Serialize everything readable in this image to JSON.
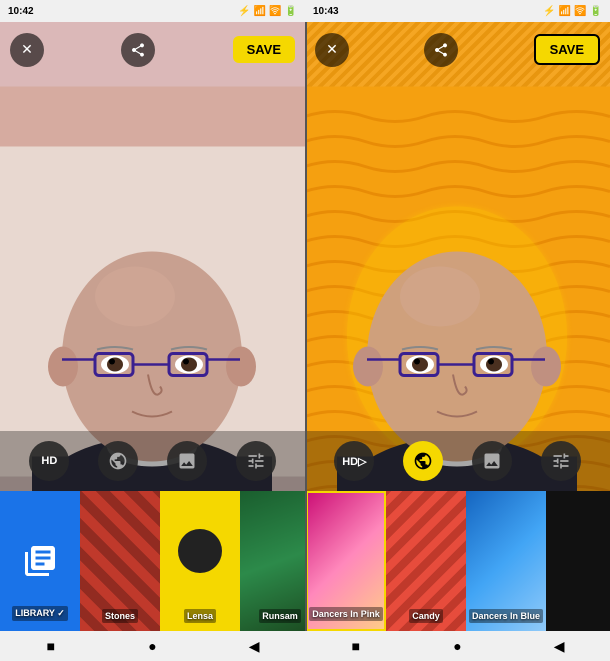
{
  "statusBar": {
    "left": {
      "time": "10:42",
      "icons": [
        "bluetooth",
        "signal",
        "wifi",
        "battery"
      ]
    },
    "right": {
      "time": "10:43",
      "icons": [
        "bluetooth",
        "signal",
        "wifi",
        "battery"
      ]
    }
  },
  "toolbar": {
    "close_label": "✕",
    "share_label": "◀",
    "save_label": "SAVE",
    "save_label_right": "SAVE"
  },
  "controls": {
    "hd_label": "HD",
    "hd_label_right": "HD▷"
  },
  "filters": {
    "left": [
      {
        "id": "library",
        "label": "LIBRARY ✓",
        "type": "library"
      },
      {
        "id": "stones",
        "label": "Stones",
        "type": "stones"
      },
      {
        "id": "lensa",
        "label": "Lensa",
        "type": "lensa"
      },
      {
        "id": "runsam",
        "label": "Runsam",
        "type": "runsam"
      }
    ],
    "right": [
      {
        "id": "dancers-pink",
        "label": "Dancers In Pink",
        "type": "dancers-pink"
      },
      {
        "id": "candy",
        "label": "Candy",
        "type": "candy"
      },
      {
        "id": "dancers-blue",
        "label": "Dancers In Blue",
        "type": "dancers-blue"
      }
    ]
  },
  "nav": {
    "buttons": [
      "■",
      "●",
      "◀"
    ]
  }
}
